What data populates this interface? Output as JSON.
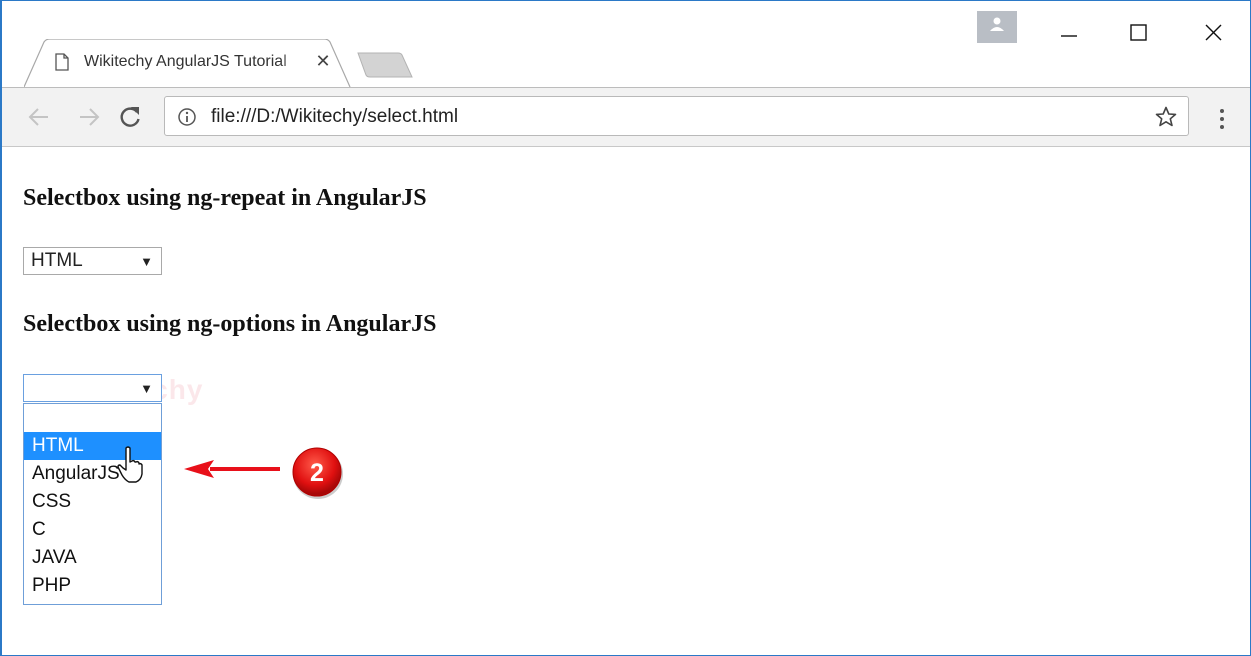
{
  "tab": {
    "title": "Wikitechy AngularJS Tutorial",
    "close_glyph": "✕"
  },
  "address_bar": {
    "url": "file:///D:/Wikitechy/select.html"
  },
  "page": {
    "heading_repeat": "Selectbox using ng-repeat in AngularJS",
    "heading_options": "Selectbox using ng-options in AngularJS",
    "select_repeat": {
      "selected": "HTML",
      "caret": "▼"
    },
    "select_options": {
      "selected": "",
      "caret": "▼"
    },
    "watermark": "Wikitechy",
    "dropdown_options": [
      "",
      "HTML",
      "AngularJS",
      "CSS",
      "C",
      "JAVA",
      "PHP"
    ],
    "highlighted_option": "HTML"
  },
  "annotation": {
    "step_number": "2",
    "arrow_color": "#e8101a",
    "badge_color": "#e01010"
  },
  "colors": {
    "window_border": "#2b79c7",
    "selection": "#1e90ff"
  },
  "icons": [
    "page-icon",
    "back-arrow-icon",
    "forward-arrow-icon",
    "reload-icon",
    "info-icon",
    "star-icon",
    "menu-dots-icon",
    "profile-icon",
    "minimize-icon",
    "maximize-icon",
    "close-icon",
    "cursor-icon"
  ]
}
